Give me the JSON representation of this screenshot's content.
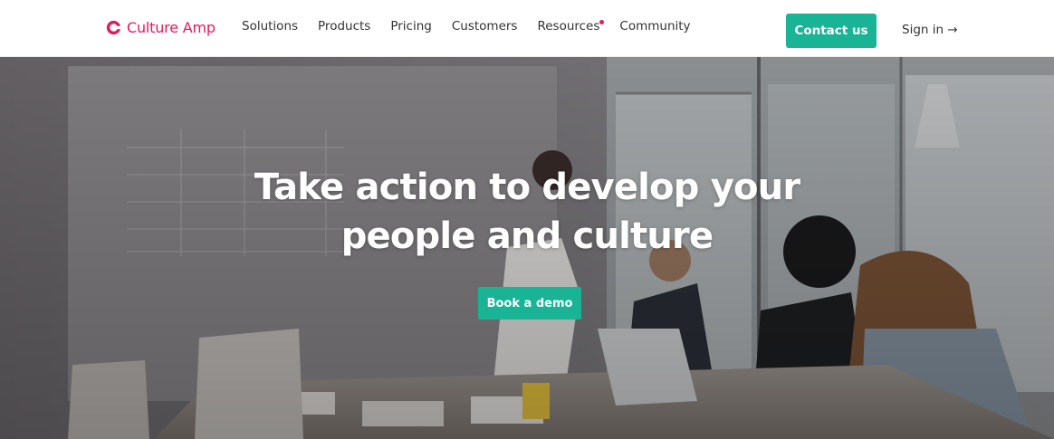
{
  "header": {
    "logo_text": "Culture Amp",
    "nav": [
      {
        "label": "Solutions"
      },
      {
        "label": "Products"
      },
      {
        "label": "Pricing"
      },
      {
        "label": "Customers"
      },
      {
        "label": "Resources"
      },
      {
        "label": "Community"
      }
    ],
    "contact_label": "Contact us",
    "signin_label": "Sign in →"
  },
  "hero": {
    "title_line1": "Take action to develop your",
    "title_line2": "people and culture",
    "cta_label": "Book a demo"
  },
  "colors": {
    "brand_pink": "#e5195e",
    "accent_green": "#19b396"
  },
  "icons": {
    "logo": "culture-amp-logo-icon",
    "resources_badge": "notification-dot-icon"
  }
}
